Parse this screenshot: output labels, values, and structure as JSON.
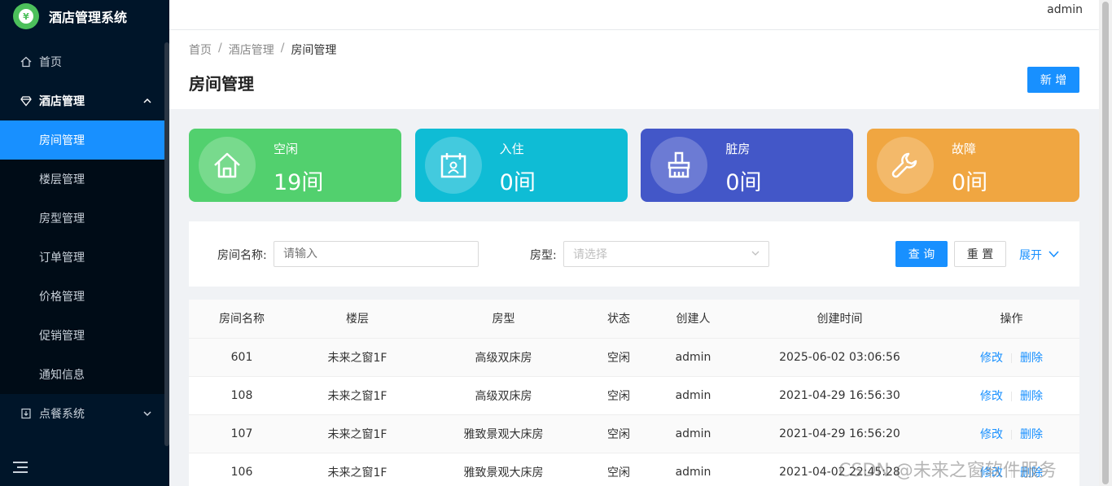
{
  "app": {
    "title": "酒店管理系统"
  },
  "sidebar": {
    "items": [
      {
        "label": "首页"
      },
      {
        "label": "酒店管理"
      },
      {
        "label": "房间管理"
      },
      {
        "label": "楼层管理"
      },
      {
        "label": "房型管理"
      },
      {
        "label": "订单管理"
      },
      {
        "label": "价格管理"
      },
      {
        "label": "促销管理"
      },
      {
        "label": "通知信息"
      },
      {
        "label": "点餐系统"
      }
    ]
  },
  "header": {
    "user": "admin"
  },
  "breadcrumb": [
    "首页",
    "酒店管理",
    "房间管理"
  ],
  "page": {
    "title": "房间管理",
    "add_label": "新 增"
  },
  "stats": [
    {
      "label": "空闲",
      "value": "19间",
      "color": "#52d06e"
    },
    {
      "label": "入住",
      "value": "0间",
      "color": "#0fbcd5"
    },
    {
      "label": "脏房",
      "value": "0间",
      "color": "#4357c8"
    },
    {
      "label": "故障",
      "value": "0间",
      "color": "#f0a641"
    }
  ],
  "search": {
    "room_name_label": "房间名称:",
    "room_name_placeholder": "请输入",
    "room_type_label": "房型:",
    "room_type_placeholder": "请选择",
    "query_label": "查 询",
    "reset_label": "重 置",
    "expand_label": "展开"
  },
  "table": {
    "columns": [
      "房间名称",
      "楼层",
      "房型",
      "状态",
      "创建人",
      "创建时间",
      "操作"
    ],
    "rows": [
      {
        "name": "601",
        "floor": "未来之窗1F",
        "type": "高级双床房",
        "status": "空闲",
        "creator": "admin",
        "time": "2025-06-02 03:06:56",
        "edit": "修改",
        "delete": "删除"
      },
      {
        "name": "108",
        "floor": "未来之窗1F",
        "type": "高级双床房",
        "status": "空闲",
        "creator": "admin",
        "time": "2021-04-29 16:56:30",
        "edit": "修改",
        "delete": "删除"
      },
      {
        "name": "107",
        "floor": "未来之窗1F",
        "type": "雅致景观大床房",
        "status": "空闲",
        "creator": "admin",
        "time": "2021-04-29 16:56:20",
        "edit": "修改",
        "delete": "删除"
      },
      {
        "name": "106",
        "floor": "未来之窗1F",
        "type": "雅致景观大床房",
        "status": "空闲",
        "creator": "admin",
        "time": "2021-04-02 22:45:28",
        "edit": "修改",
        "delete": "删除"
      }
    ]
  },
  "watermark": "CSDN @未来之窗软件服务"
}
